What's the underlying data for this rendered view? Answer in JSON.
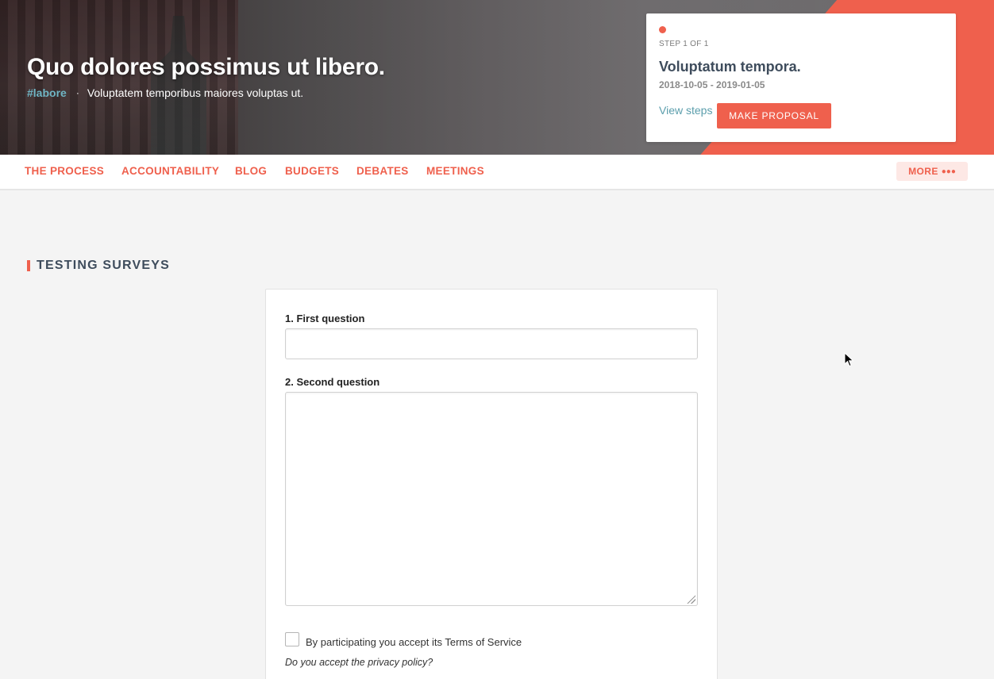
{
  "hero": {
    "title": "Quo dolores possimus ut libero.",
    "hashtag": "#labore",
    "separator": "·",
    "subtitle": "Voluptatem temporibus maiores voluptas ut."
  },
  "step_card": {
    "step_label": "STEP 1 OF 1",
    "title": "Voluptatum tempora.",
    "dates": "2018-10-05 - 2019-01-05",
    "view_steps": "View steps",
    "make_proposal": "MAKE PROPOSAL"
  },
  "nav": {
    "items": [
      {
        "label": "THE PROCESS"
      },
      {
        "label": "ACCOUNTABILITY"
      },
      {
        "label": "BLOG"
      },
      {
        "label": "BUDGETS"
      },
      {
        "label": "DEBATES"
      },
      {
        "label": "MEETINGS"
      }
    ],
    "more": "MORE",
    "more_dots": "●●●"
  },
  "section": {
    "title": "TESTING SURVEYS"
  },
  "survey": {
    "questions": [
      {
        "label": "1. First question",
        "value": ""
      },
      {
        "label": "2. Second question",
        "value": ""
      }
    ],
    "tos_label": "By participating you accept its Terms of Service",
    "tos_checked": false,
    "privacy_question": "Do you accept the privacy policy?"
  },
  "colors": {
    "accent": "#ef604d",
    "link": "#5b9eac",
    "text": "#3e4c5c",
    "background": "#f4f4f4"
  }
}
